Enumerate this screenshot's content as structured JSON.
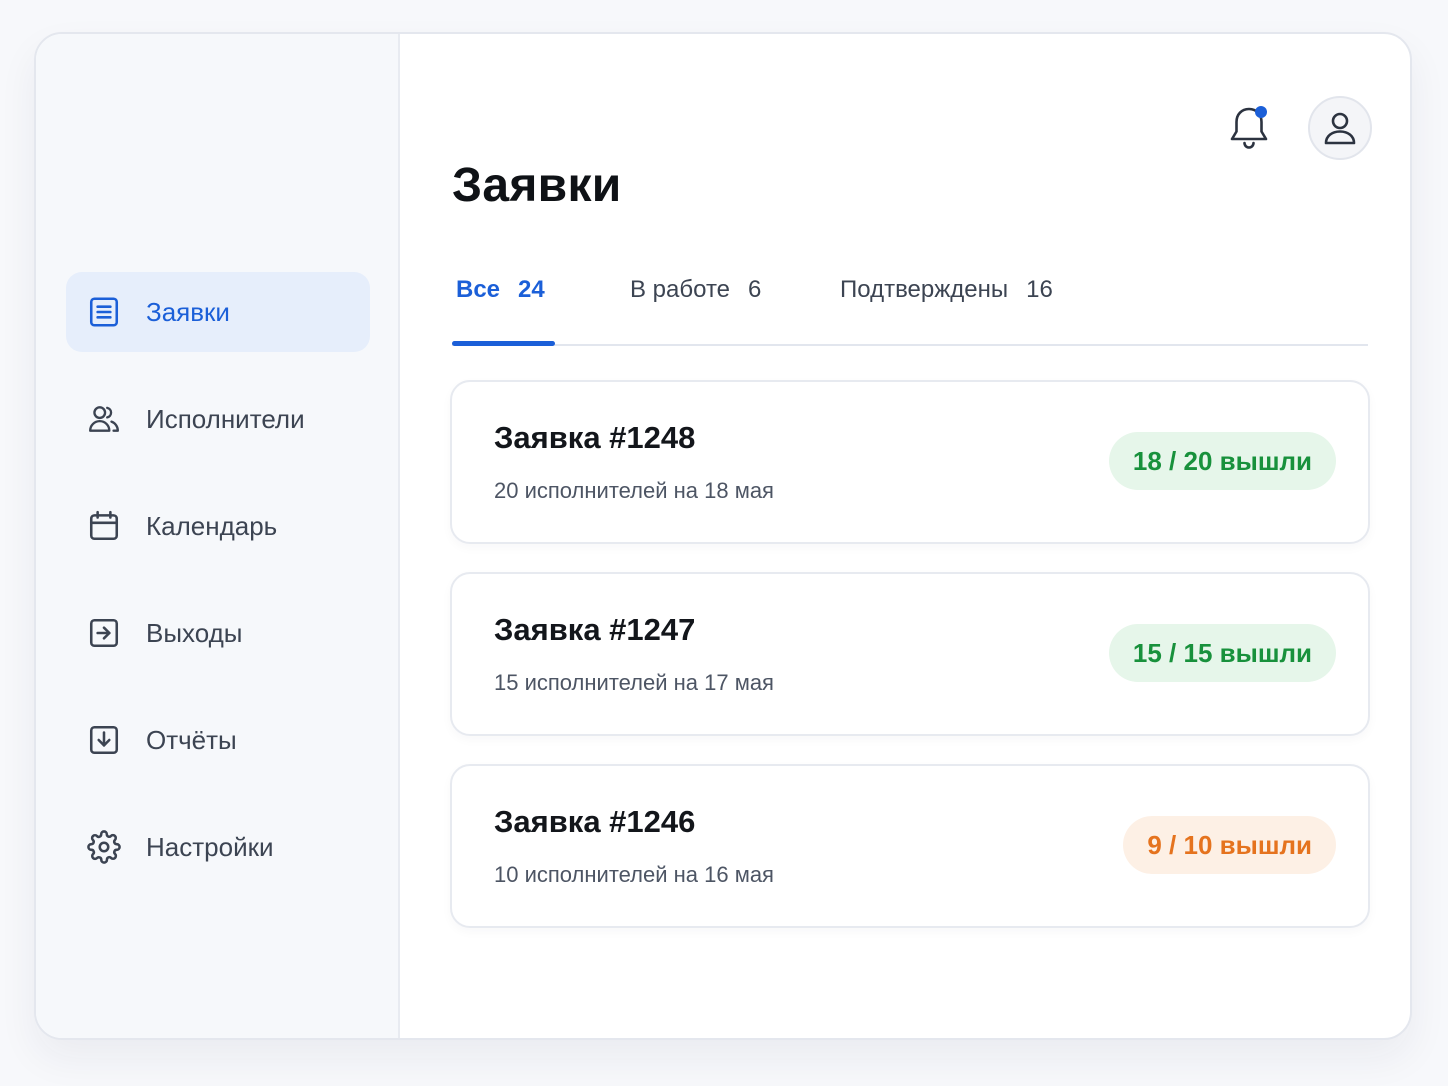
{
  "sidebar": {
    "items": [
      {
        "label": "Заявки",
        "icon": "list-icon",
        "active": true
      },
      {
        "label": "Исполнители",
        "icon": "users-icon"
      },
      {
        "label": "Календарь",
        "icon": "calendar-icon"
      },
      {
        "label": "Выходы",
        "icon": "exit-icon"
      },
      {
        "label": "Отчёты",
        "icon": "download-icon"
      },
      {
        "label": "Настройки",
        "icon": "gear-icon"
      }
    ]
  },
  "header": {
    "title": "Заявки",
    "notifications_icon": "bell-icon",
    "profile_icon": "user-icon"
  },
  "tabs": [
    {
      "label": "Все",
      "count": "24",
      "active": true
    },
    {
      "label": "В работе",
      "count": "6"
    },
    {
      "label": "Подтверждены",
      "count": "16"
    }
  ],
  "requests": [
    {
      "title": "Заявка #1248",
      "subtitle": "20 исполнителей на 18 мая",
      "badge": "18 / 20 вышли",
      "status": "green"
    },
    {
      "title": "Заявка #1247",
      "subtitle": "15 исполнителей на 17 мая",
      "badge": "15 / 15 вышли",
      "status": "green"
    },
    {
      "title": "Заявка #1246",
      "subtitle": "10 исполнителей на 16 мая",
      "badge": "9 / 10 вышли",
      "status": "orange"
    }
  ],
  "colors": {
    "accent": "#1b5fd8",
    "success": "#18913c",
    "warning": "#e5731e"
  }
}
